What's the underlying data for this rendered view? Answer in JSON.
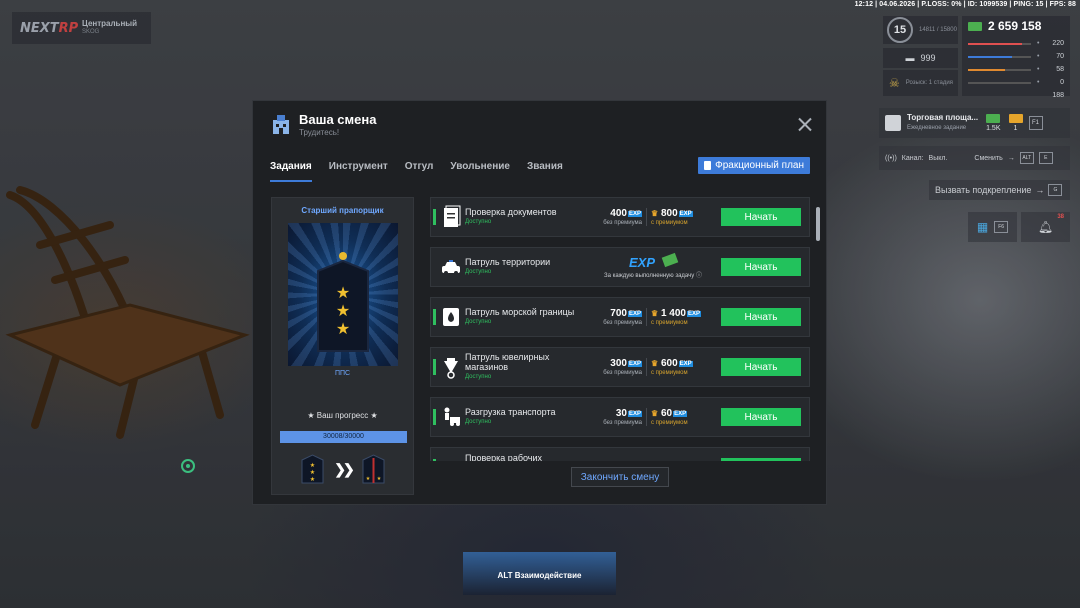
{
  "status_bar": "12:12 | 04.06.2026 | P.LOSS: 0% | ID: 1099539 | PING: 15 | FPS: 88",
  "logo": {
    "brand": "NEXTRP",
    "server": "Центральный",
    "server_sub": "SKOG"
  },
  "hud": {
    "level": "15",
    "xp": "14811 / 15800",
    "count": "999",
    "wanted": "Розыск: 1 стадия",
    "money": "2 659 158",
    "stats": [
      {
        "icon": "heart-rate-icon",
        "value": "220",
        "color": "#e05050",
        "fill": 0.85
      },
      {
        "icon": "food-icon",
        "value": "70",
        "color": "#3d7bd9",
        "fill": 0.7
      },
      {
        "icon": "water-icon",
        "value": "58",
        "color": "#e08a30",
        "fill": 0.58
      },
      {
        "icon": "armor-icon",
        "value": "0",
        "color": "#c9ccd1",
        "fill": 0.0
      }
    ],
    "stat_extra": "188",
    "quest": {
      "title": "Торговая площа...",
      "subtitle": "Ежедневное задание",
      "reward1": "1.5K",
      "reward2": "1",
      "key": "F1"
    },
    "radio": {
      "label": "Канал:",
      "value": "Выкл.",
      "change": "Сменить",
      "k1": "ALT",
      "k2": "E"
    },
    "backup": {
      "label": "Вызвать подкрепление",
      "key": "G"
    },
    "icons": [
      {
        "name": "calendar-icon",
        "key": "F6"
      },
      {
        "name": "bell-icon",
        "badge": "38"
      }
    ]
  },
  "modal": {
    "title": "Ваша смена",
    "subtitle": "Трудитесь!",
    "tabs": [
      "Задания",
      "Инструмент",
      "Отгул",
      "Увольнение",
      "Звания"
    ],
    "faction_button": "Фракционный план",
    "rank": {
      "name": "Старший прапорщик",
      "group": "ППС",
      "progress_title": "★ Ваш прогресс ★",
      "progress_text": "30008/30000",
      "progress_fraction": 1.0
    },
    "tasks": [
      {
        "name": "Проверка документов",
        "status": "Доступно",
        "base": "400",
        "prem": "800",
        "base_note": "без премиума",
        "prem_note": "с премиумом",
        "button": "Начать"
      },
      {
        "name": "Патруль территории",
        "status": "Доступно",
        "special": "За каждую выполненную задачу",
        "exp_label": "EXP",
        "button": "Начать"
      },
      {
        "name": "Патруль морской границы",
        "status": "Доступно",
        "base": "700",
        "prem": "1 400",
        "base_note": "без премиума",
        "prem_note": "с премиумом",
        "button": "Начать"
      },
      {
        "name": "Патруль ювелирных магазинов",
        "status": "Доступно",
        "base": "300",
        "prem": "600",
        "base_note": "без премиума",
        "prem_note": "с премиумом",
        "button": "Начать"
      },
      {
        "name": "Разгрузка транспорта",
        "status": "Доступно",
        "base": "30",
        "prem": "60",
        "base_note": "без премиума",
        "prem_note": "с премиумом",
        "button": "Начать"
      },
      {
        "name": "Проверка рабочих",
        "status": "",
        "button": ""
      }
    ],
    "end_button": "Закончить смену"
  },
  "interact_hint": "ALT Взаимодействие"
}
